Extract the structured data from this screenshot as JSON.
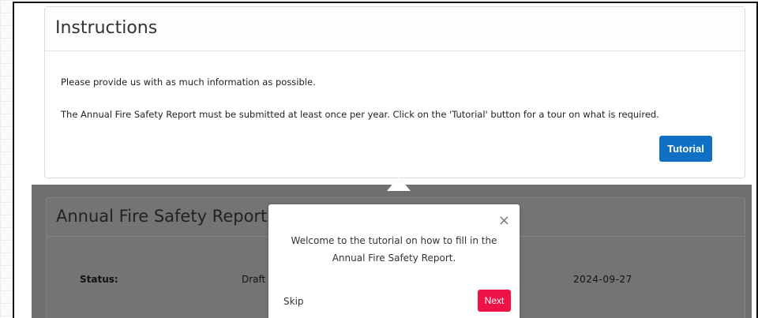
{
  "instructions": {
    "title": "Instructions",
    "line1": "Please provide us with as much information as possible.",
    "line2": "The Annual Fire Safety Report must be submitted at least once per year. Click on the 'Tutorial' button for a tour on what is required.",
    "tutorial_button": "Tutorial"
  },
  "report": {
    "title": "Annual Fire Safety Report",
    "status_label": "Status:",
    "status_value": "Draft",
    "date_value": "2024-09-27"
  },
  "tour_popover": {
    "message": "Welcome to the tutorial on how to fill in the Annual Fire Safety Report.",
    "close_glyph": "×",
    "skip_label": "Skip",
    "next_label": "Next"
  },
  "colors": {
    "tutorial_button": "#0f6fc2",
    "next_button": "#ee1249",
    "overlay": "#6f6f6f"
  },
  "icons": [
    "close-icon"
  ]
}
